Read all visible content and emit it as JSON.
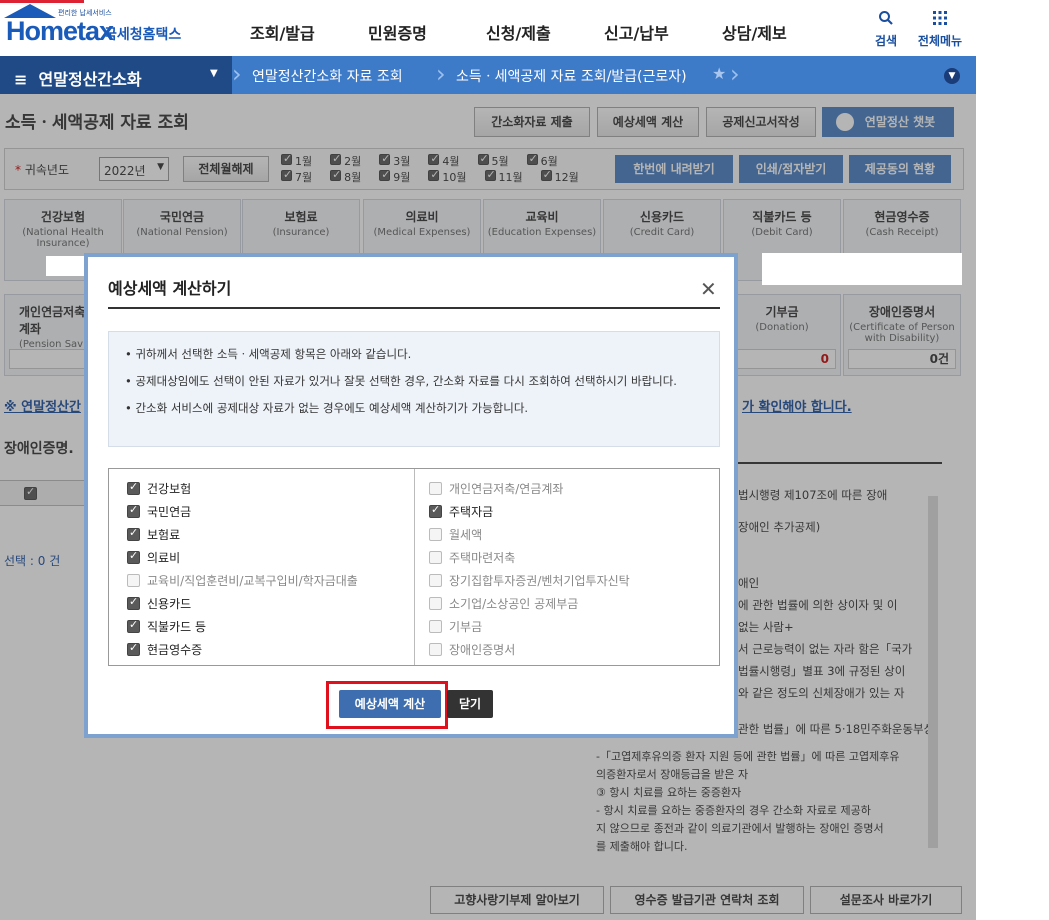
{
  "header": {
    "logo_small": "편리한 납세서비스",
    "logo_main": "Hometax",
    "logo_kr": "국세청홈택스",
    "gnb": [
      "조회/발급",
      "민원증명",
      "신청/제출",
      "신고/납부",
      "상담/제보"
    ],
    "search_label": "검색",
    "menu_label": "전체메뉴"
  },
  "nav": {
    "section": "연말정산간소화",
    "crumb1": "연말정산간소화 자료 조회",
    "crumb2": "소득ㆍ세액공제 자료 조회/발급(근로자)"
  },
  "page": {
    "title": "소득ㆍ세액공제 자료 조회",
    "buttons": [
      "간소화자료 제출",
      "예상세액 계산",
      "공제신고서작성"
    ],
    "chatbot": "연말정산 챗봇",
    "year_label": "귀속년도",
    "year_value": "2022년",
    "select_all": "전체월해제",
    "months_top": [
      "1월",
      "2월",
      "3월",
      "4월",
      "5월",
      "6월"
    ],
    "months_bottom": [
      "7월",
      "8월",
      "9월",
      "10월",
      "11월",
      "12월"
    ],
    "action_buttons": [
      "한번에 내려받기",
      "인쇄/점자받기",
      "제공동의 현황"
    ],
    "cards_row1": [
      {
        "name": "건강보험",
        "en": "(National Health Insurance)"
      },
      {
        "name": "국민연금",
        "en": "(National Pension)"
      },
      {
        "name": "보험료",
        "en": "(Insurance)"
      },
      {
        "name": "의료비",
        "en": "(Medical Expenses)"
      },
      {
        "name": "교육비",
        "en": "(Education Expenses)"
      },
      {
        "name": "신용카드",
        "en": "(Credit Card)"
      },
      {
        "name": "직불카드 등",
        "en": "(Debit Card)"
      },
      {
        "name": "현금영수증",
        "en": "(Cash Receipt)"
      }
    ],
    "cards_row2_left": {
      "name": "개인연금저축 연금계좌",
      "en": "(Pension Sav"
    },
    "cards_row2_right": [
      {
        "name": "기부금",
        "en": "(Donation)",
        "value": "0"
      },
      {
        "name": "장애인증명서",
        "en": "(Certificate of Person with Disability)",
        "value": "0건"
      }
    ],
    "notice_left": "※ 연말정산간",
    "notice_right": "가 확인해야 합니다.",
    "section_label": "장애인증명.",
    "selection": "선택 : 0 건",
    "right_texts": [
      "법시행령 제107조에 따른 장애",
      "장애인 추가공제)",
      "애인",
      "에 관한 법률에 의한 상이자 및 이",
      "없는 사람+",
      "서 근로능력이 없는 자라 함은「국가",
      "법률시행령」별표 3에 규정된 상이",
      "와 같은 정도의 신체장애가 있는 자",
      "관한 법률」에 따른 5·18민주화운동부상",
      "-「고엽제후유의증 환자 지원 등에 관한 법률」에 따른 고엽제후유",
      "의증환자로서 장애등급을 받은 자",
      "③ 항시 치료를 요하는 중증환자",
      "- 항시 치료를 요하는 중증환자의 경우 간소화 자료로 제공하",
      "지 않으므로 종전과 같이 의료기관에서 발행하는 장애인 증명서",
      "를 제출해야 합니다."
    ],
    "bottom_buttons": [
      "고향사랑기부제 알아보기",
      "영수증 발급기관 연락처 조회",
      "설문조사 바로가기"
    ]
  },
  "modal": {
    "title": "예상세액 계산하기",
    "notices": [
      "귀하께서 선택한 소득ㆍ세액공제 항목은 아래와 같습니다.",
      "공제대상임에도 선택이 안된 자료가 있거나 잘못 선택한 경우, 간소화 자료를 다시 조회하여 선택하시기 바랍니다.",
      "간소화 서비스에 공제대상 자료가 없는 경우에도 예상세액 계산하기가 가능합니다."
    ],
    "left_items": [
      {
        "label": "건강보험",
        "checked": true
      },
      {
        "label": "국민연금",
        "checked": true
      },
      {
        "label": "보험료",
        "checked": true
      },
      {
        "label": "의료비",
        "checked": true
      },
      {
        "label": "교육비/직업훈련비/교복구입비/학자금대출",
        "checked": false
      },
      {
        "label": "신용카드",
        "checked": true
      },
      {
        "label": "직불카드 등",
        "checked": true
      },
      {
        "label": "현금영수증",
        "checked": true
      }
    ],
    "right_items": [
      {
        "label": "개인연금저축/연금계좌",
        "checked": false
      },
      {
        "label": "주택자금",
        "checked": true
      },
      {
        "label": "월세액",
        "checked": false
      },
      {
        "label": "주택마련저축",
        "checked": false
      },
      {
        "label": "장기집합투자증권/벤처기업투자신탁",
        "checked": false
      },
      {
        "label": "소기업/소상공인 공제부금",
        "checked": false
      },
      {
        "label": "기부금",
        "checked": false
      },
      {
        "label": "장애인증명서",
        "checked": false
      }
    ],
    "calc_button": "예상세액 계산",
    "close_button": "닫기"
  }
}
